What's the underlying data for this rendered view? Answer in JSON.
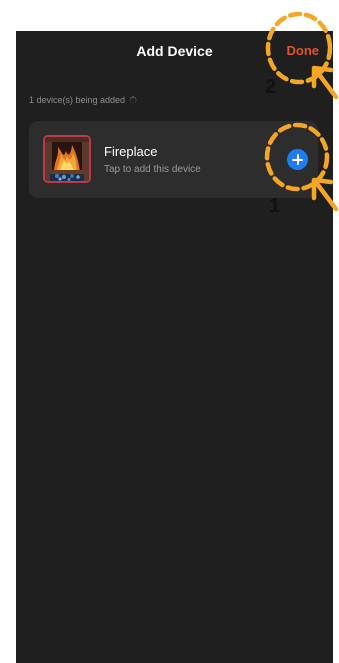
{
  "header": {
    "title": "Add Device",
    "done_label": "Done"
  },
  "status": {
    "text": "1 device(s) being added"
  },
  "device": {
    "name": "Fireplace",
    "subtitle": "Tap to add this device",
    "icon": "fireplace-thumbnail",
    "action_icon": "add-circle-icon"
  },
  "annotations": {
    "step_1": "1",
    "step_2": "2"
  },
  "colors": {
    "background": "#1f1f1f",
    "card": "#2d2d2d",
    "done": "#e0532e",
    "add_button": "#1d7df0",
    "annotation": "#f5a623"
  }
}
